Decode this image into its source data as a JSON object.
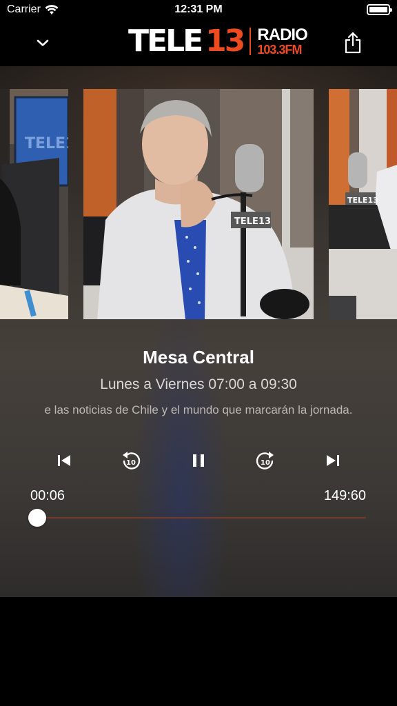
{
  "status_bar": {
    "carrier": "Carrier",
    "time": "12:31 PM"
  },
  "header": {
    "logo": {
      "tele": "TELE",
      "number": "13",
      "radio": "RADIO",
      "frequency": "103.3FM"
    },
    "down_icon": "chevron-down-icon",
    "share_icon": "share-icon"
  },
  "carousel": {
    "items": [
      {
        "position": "previous",
        "image": "studio-host-left"
      },
      {
        "position": "current",
        "image": "studio-host-microphone",
        "mic_flag": "TELE13"
      },
      {
        "position": "next",
        "image": "studio-microphone-right",
        "mic_flag": "TELE13"
      }
    ]
  },
  "program": {
    "title": "Mesa Central",
    "schedule": "Lunes a Viernes 07:00 a 09:30",
    "description": "e las noticias de Chile y el mundo que marcarán la jornada."
  },
  "controls": {
    "previous_icon": "skip-previous-icon",
    "rewind_icon": "replay-10-icon",
    "rewind_seconds": "10",
    "pause_icon": "pause-icon",
    "forward_icon": "forward-10-icon",
    "forward_seconds": "10",
    "next_icon": "skip-next-icon"
  },
  "progress": {
    "current": "00:06",
    "duration": "149:60",
    "fraction": 0.0
  },
  "colors": {
    "accent": "#ee4a1f",
    "background": "#000000"
  }
}
